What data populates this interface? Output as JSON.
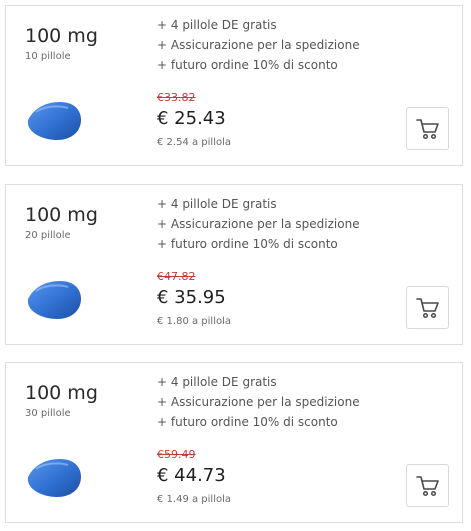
{
  "offers": [
    {
      "dose": "100 mg",
      "count": "10 pillole",
      "features": [
        "+ 4 pillole DE gratis",
        "+ Assicurazione per la spedizione",
        "+ futuro ordine 10% di sconto"
      ],
      "old_price": "€33.82",
      "price": "€ 25.43",
      "per_pill": "€ 2.54 a pillola",
      "cart_icon": "shopping-cart-icon"
    },
    {
      "dose": "100 mg",
      "count": "20 pillole",
      "features": [
        "+ 4 pillole DE gratis",
        "+ Assicurazione per la spedizione",
        "+ futuro ordine 10% di sconto"
      ],
      "old_price": "€47.82",
      "price": "€ 35.95",
      "per_pill": "€ 1.80 a pillola",
      "cart_icon": "shopping-cart-icon"
    },
    {
      "dose": "100 mg",
      "count": "30 pillole",
      "features": [
        "+ 4 pillole DE gratis",
        "+ Assicurazione per la spedizione",
        "+ futuro ordine 10% di sconto"
      ],
      "old_price": "€59.49",
      "price": "€ 44.73",
      "per_pill": "€ 1.49 a pillola",
      "cart_icon": "shopping-cart-icon"
    }
  ],
  "colors": {
    "old_price": "#c23b3b",
    "pill_blue": "#2f6fd0",
    "card_border": "#dedede"
  }
}
